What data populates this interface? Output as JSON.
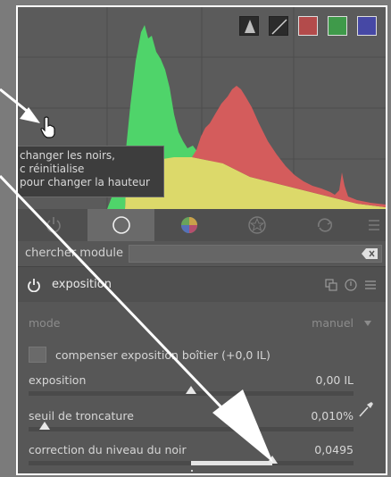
{
  "histogram": {
    "buttons": [
      {
        "name": "histogram-mode-icon",
        "color": "#2b2b2b"
      },
      {
        "name": "histogram-linear-icon",
        "color": "#2b2b2b"
      },
      {
        "name": "red-channel-toggle",
        "color": "#b34b4b"
      },
      {
        "name": "green-channel-toggle",
        "color": "#3f9a4a"
      },
      {
        "name": "blue-channel-toggle",
        "color": "#4648a5"
      }
    ]
  },
  "tooltip": {
    "lines": [
      "changer les noirs,",
      "c réinitialise",
      "pour changer la hauteur"
    ]
  },
  "tabs": {
    "icons": [
      "power-icon",
      "circle-icon",
      "color-wheel-icon",
      "effects-icon",
      "refresh-icon"
    ],
    "active_index": 1
  },
  "search": {
    "label": "chercher module"
  },
  "module": {
    "title": "exposition",
    "rows": {
      "mode_label": "mode",
      "mode_value": "manuel",
      "compensate_label": "compenser exposition boîtier (+0,0 IL)",
      "exposure_label": "exposition",
      "exposure_value": "0,00 IL",
      "exposure_position": 0.5,
      "clip_label": "seuil de troncature",
      "clip_value": "0,010%",
      "clip_position": 0.05,
      "black_label": "correction du niveau du noir",
      "black_value": "0,0495",
      "black_position": 0.75,
      "black_fill_start": 0.5
    }
  },
  "colors": {
    "histogram_green": "#4fd46a",
    "histogram_red": "#d45c5c",
    "histogram_yellow": "#dcd96a"
  }
}
